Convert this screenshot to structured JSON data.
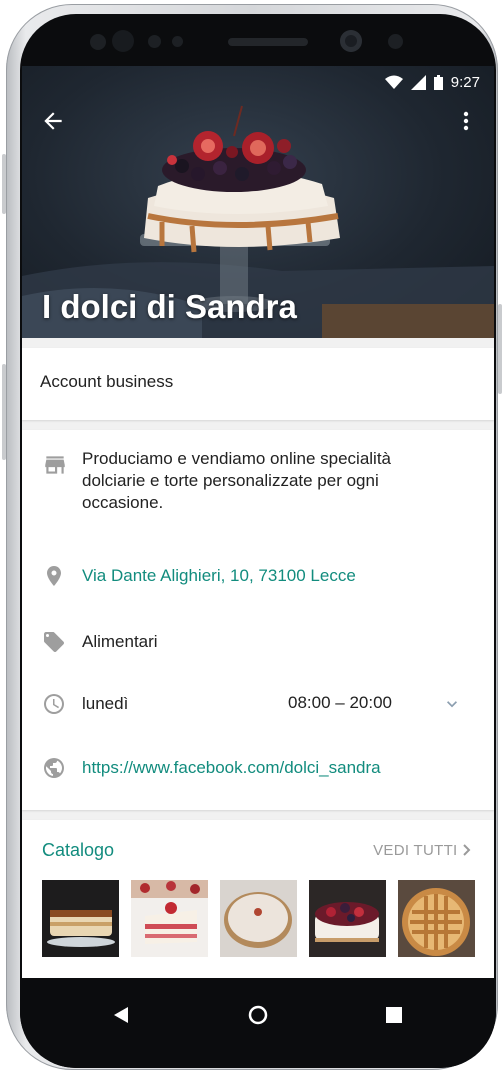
{
  "status_bar": {
    "time": "9:27"
  },
  "header": {
    "title": "I dolci di Sandra"
  },
  "account": {
    "type_label": "Account business"
  },
  "info": {
    "description": "Produciamo e vendiamo online specialità dolciarie e torte personalizzate per ogni occasione.",
    "address": "Via Dante Alighieri, 10, 73100 Lecce",
    "category": "Alimentari",
    "hours_day": "lunedì",
    "hours_time": "08:00 – 20:00",
    "website": "https://www.facebook.com/dolci_sandra"
  },
  "catalog": {
    "title": "Catalogo",
    "see_all_label": "VEDI TUTTI",
    "items": [
      {
        "icon": "tiramisu-cake-image"
      },
      {
        "icon": "strawberry-cake-slice-image"
      },
      {
        "icon": "powdered-cake-image"
      },
      {
        "icon": "berry-cheesecake-image"
      },
      {
        "icon": "lattice-tart-image"
      }
    ]
  },
  "colors": {
    "accent": "#128c7e",
    "icon_gray": "#9e9e9e"
  },
  "icons": [
    "back-arrow-icon",
    "more-vert-icon",
    "store-icon",
    "location-pin-icon",
    "tag-icon",
    "clock-icon",
    "chevron-down-icon",
    "globe-icon",
    "chevron-right-icon",
    "nav-back-icon",
    "nav-home-icon",
    "nav-recents-icon"
  ]
}
